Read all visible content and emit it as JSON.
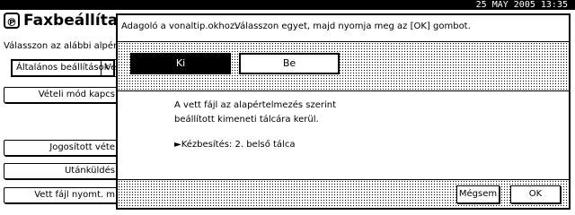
{
  "status_bar": {
    "datetime": "25 MAY   2005 13:35"
  },
  "background": {
    "title": "Faxbeállíta",
    "subtitle": "Válasszon az alábbi alpértel",
    "tab_general": "Általános beállítások",
    "tab_other": "Ve",
    "buttons": [
      "Vételi mód kapcs",
      "Jogosított véte",
      "Utánküldés",
      "Vett fájl nyomt. m"
    ]
  },
  "dialog": {
    "label": "Adagoló a vonaltip.okhoz:",
    "instruction": "Válasszon egyet, majd nyomja meg az [OK] gombot.",
    "options": [
      {
        "label": "Ki",
        "selected": true
      },
      {
        "label": "Be",
        "selected": false
      }
    ],
    "description_line1": "A vett fájl az alapértelmezés szerint",
    "description_line2": "beállított kimeneti tálcára kerül.",
    "destination": "Kézbesítés: 2. belső tálca",
    "cancel_label": "Mégsem",
    "ok_label": "OK"
  }
}
